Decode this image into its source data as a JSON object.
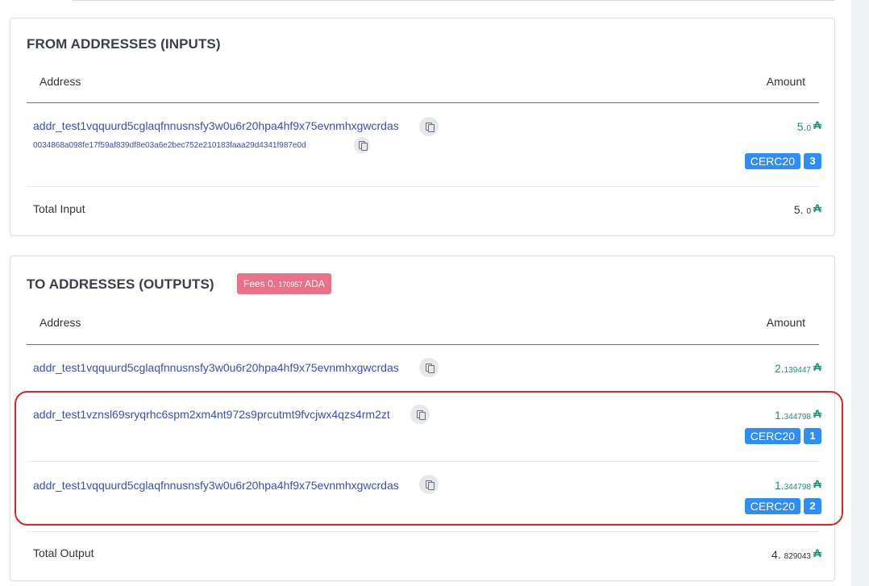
{
  "inputs": {
    "title": "FROM ADDRESSES (INPUTS)",
    "col_address": "Address",
    "col_amount": "Amount",
    "rows": [
      {
        "address": "addr_test1vqquurd5cglaqfnnusnsfy3w0u6r20hpa4hf9x75evnmhxgwcrdas",
        "tx_hash": "0034868a098fe17f59af839df8e03a6e2bec752e210183faaa29d4341f987e0d",
        "amount_int": "5.",
        "amount_frac": "0",
        "token_name": "CERC20",
        "token_count": "3"
      }
    ],
    "total_label": "Total Input",
    "total_int": "5.",
    "total_frac": "0"
  },
  "outputs": {
    "title": "TO ADDRESSES (OUTPUTS)",
    "fees_prefix": "Fees 0.",
    "fees_frac": "170957",
    "fees_unit": "ADA",
    "col_address": "Address",
    "col_amount": "Amount",
    "rows": [
      {
        "address": "addr_test1vqquurd5cglaqfnnusnsfy3w0u6r20hpa4hf9x75evnmhxgwcrdas",
        "amount_int": "2.",
        "amount_frac": "139447"
      },
      {
        "address": "addr_test1vznsl69sryqrhc6spm2xm4nt972s9prcutmt9fvcjwx4qzs4rm2zt",
        "amount_int": "1.",
        "amount_frac": "344798",
        "token_name": "CERC20",
        "token_count": "1"
      },
      {
        "address": "addr_test1vqquurd5cglaqfnnusnsfy3w0u6r20hpa4hf9x75evnmhxgwcrdas",
        "amount_int": "1.",
        "amount_frac": "344798",
        "token_name": "CERC20",
        "token_count": "2"
      }
    ],
    "total_label": "Total Output",
    "total_int": "4.",
    "total_frac": "829043"
  },
  "icons": {
    "copy": "copy-icon",
    "ada": "ada-icon",
    "ada_glyph": "₳"
  },
  "colors": {
    "link": "#3b4dbf",
    "ada_green": "#1a9479",
    "token_blue": "#2f8ef6",
    "fees_pink": "#e8728a",
    "highlight_red": "#e0222a"
  }
}
